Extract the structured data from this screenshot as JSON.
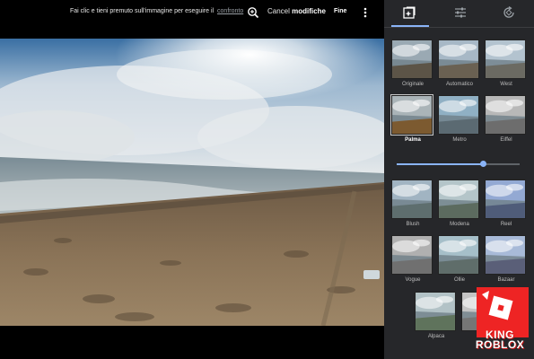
{
  "toolbar": {
    "hint_text": "Fai clic e tieni premuto sull'immagine per eseguire il",
    "hint_link": "confronto",
    "cancel_prefix": "Cancel",
    "cancel_label": "modifiche",
    "done_label": "Fine",
    "zoom_icon": "zoom-in-icon",
    "more_icon": "more-vert-icon"
  },
  "panel": {
    "tabs": [
      {
        "name": "filters",
        "icon": "photo-filter-icon",
        "active": true
      },
      {
        "name": "adjust",
        "icon": "sliders-icon",
        "active": false
      },
      {
        "name": "crop-rotate",
        "icon": "rotate-icon",
        "active": false
      }
    ],
    "accent": "#8ab4f8",
    "filters": [
      {
        "label": "Originale",
        "selected": false
      },
      {
        "label": "Automatico",
        "selected": false
      },
      {
        "label": "West",
        "selected": false
      },
      {
        "label": "Palma",
        "selected": true
      },
      {
        "label": "Metro",
        "selected": false
      },
      {
        "label": "Eiffel",
        "selected": false
      },
      {
        "label": "Blush",
        "selected": false
      },
      {
        "label": "Modena",
        "selected": false
      },
      {
        "label": "Reel",
        "selected": false
      },
      {
        "label": "Vogue",
        "selected": false
      },
      {
        "label": "Ollie",
        "selected": false
      },
      {
        "label": "Bazaar",
        "selected": false
      },
      {
        "label": "Alpaca",
        "selected": false
      },
      {
        "label": "",
        "selected": false
      }
    ],
    "intensity": 0.7
  },
  "watermark": {
    "line1": "KING",
    "line2": "ROBLOX"
  }
}
